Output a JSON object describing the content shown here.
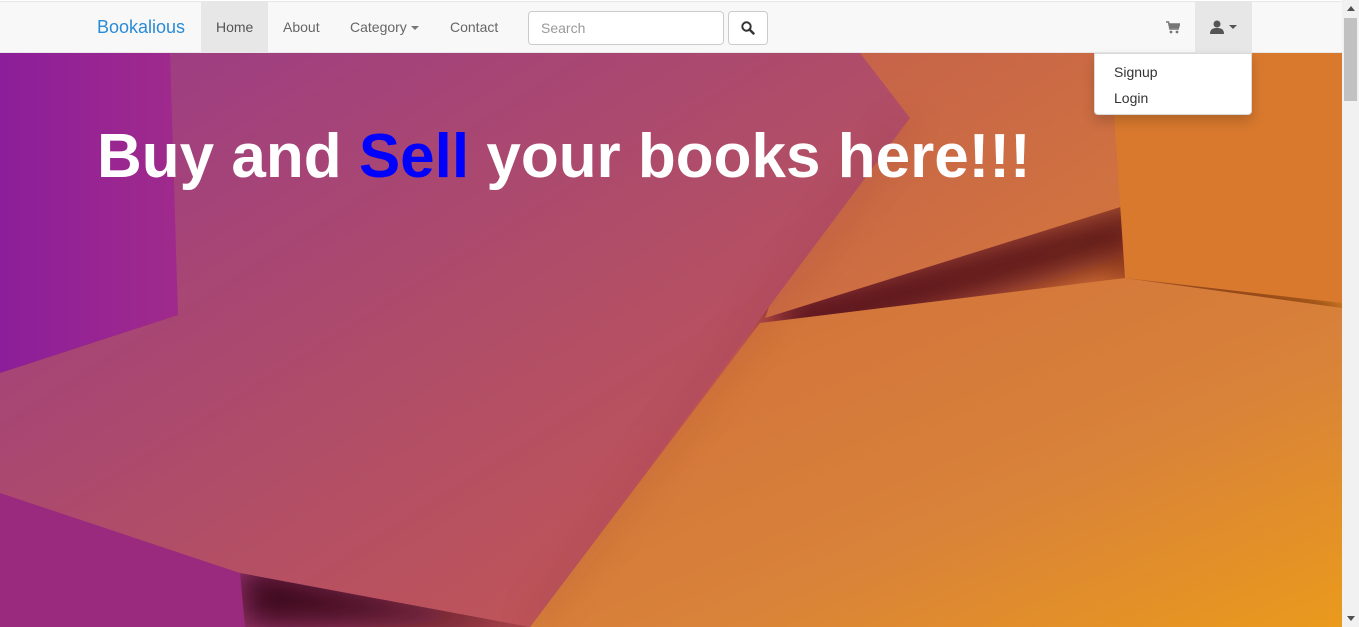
{
  "navbar": {
    "brand": "Bookalious",
    "links": {
      "home": "Home",
      "about": "About",
      "category": "Category",
      "contact": "Contact"
    },
    "search": {
      "placeholder": "Search",
      "button_icon": "search-icon"
    },
    "cart_icon": "shopping-cart-icon",
    "user_icon": "user-icon"
  },
  "dropdown": {
    "items": [
      "Signup",
      "Login"
    ]
  },
  "hero": {
    "title_part1": "Buy and ",
    "title_accent": "Sell",
    "title_part2": " your books here!!!",
    "accent_color": "#0000ff"
  },
  "colors": {
    "brand": "#2a8bd6",
    "navbar_bg": "#f8f8f8",
    "active_tab_bg": "#e7e7e7"
  }
}
